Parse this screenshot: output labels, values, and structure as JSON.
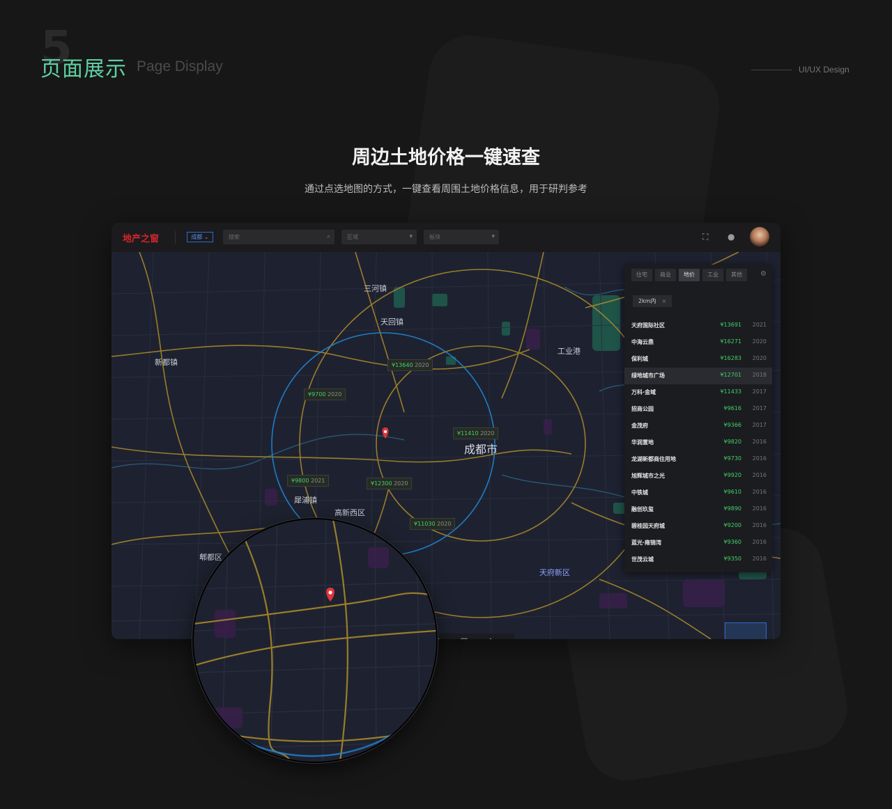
{
  "header": {
    "section_number": "5",
    "section_title": "页面展示",
    "section_title_en": "Page Display",
    "tagline": "UI/UX Design"
  },
  "hero": {
    "title": "周边土地价格一键速查",
    "subtitle": "通过点选地图的方式，一键查看周围土地价格信息，用于研判参考"
  },
  "app": {
    "logo": "地产之窗",
    "city_button": "成都 ⌄",
    "search_placeholder": "搜索",
    "select_1": "区域",
    "select_2": "板块",
    "icons": [
      "fullscreen-icon",
      "notification-icon"
    ],
    "map": {
      "labels": {
        "l1": "三河镇",
        "l2": "天回镇",
        "l3": "新都镇",
        "l4": "成都市",
        "l5": "高新西区",
        "l6": "郫都区",
        "l7": "犀浦镇",
        "l8": "工业港",
        "l9": "天府新区"
      },
      "price_tags": [
        {
          "price": "¥13640",
          "year": "2020"
        },
        {
          "price": "¥9700",
          "year": "2020"
        },
        {
          "price": "¥11410",
          "year": "2020"
        },
        {
          "price": "¥9800",
          "year": "2021"
        },
        {
          "price": "¥12300",
          "year": "2020"
        },
        {
          "price": "¥11030",
          "year": "2020"
        }
      ]
    },
    "panel": {
      "tabs": [
        "住宅",
        "商业",
        "地价",
        "工业",
        "其他"
      ],
      "active_tab": "地价",
      "radius_chip": "2km内",
      "list": [
        {
          "name": "天府国际社区",
          "price": "¥13691",
          "year": "2021"
        },
        {
          "name": "中海云鼎",
          "price": "¥16271",
          "year": "2020"
        },
        {
          "name": "保利城",
          "price": "¥16283",
          "year": "2020"
        },
        {
          "name": "绿地城市广场",
          "price": "¥12701",
          "year": "2018"
        },
        {
          "name": "万科·金域",
          "price": "¥11433",
          "year": "2017"
        },
        {
          "name": "招商公园",
          "price": "¥9616",
          "year": "2017"
        },
        {
          "name": "金茂府",
          "price": "¥9366",
          "year": "2017"
        },
        {
          "name": "华润置地",
          "price": "¥9820",
          "year": "2016"
        },
        {
          "name": "龙湖新都商住用地",
          "price": "¥9730",
          "year": "2016"
        },
        {
          "name": "旭辉城市之光",
          "price": "¥9920",
          "year": "2016"
        },
        {
          "name": "中铁城",
          "price": "¥9610",
          "year": "2016"
        },
        {
          "name": "融创玖玺",
          "price": "¥9890",
          "year": "2016"
        },
        {
          "name": "碧桂园天府城",
          "price": "¥9200",
          "year": "2016"
        },
        {
          "name": "蓝光·雍锦湾",
          "price": "¥9360",
          "year": "2016"
        },
        {
          "name": "世茂云城",
          "price": "¥9350",
          "year": "2016"
        }
      ]
    },
    "bottom_tools": [
      {
        "icon": "locate-icon",
        "label": "定位"
      },
      {
        "icon": "print-icon",
        "label": "打印"
      },
      {
        "icon": "layer-icon",
        "label": "图层"
      }
    ]
  }
}
